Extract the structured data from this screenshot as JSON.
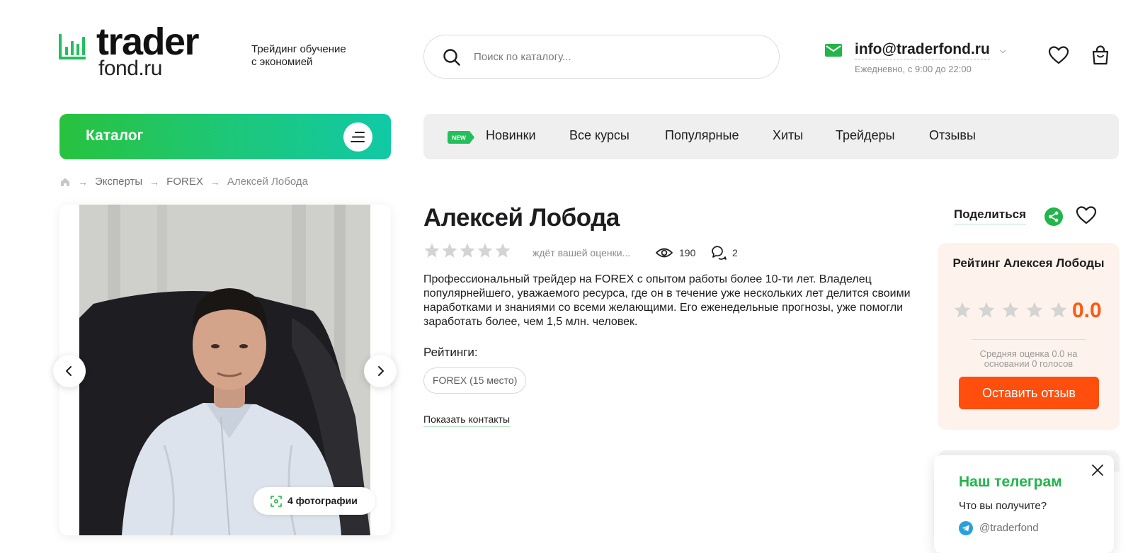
{
  "header": {
    "logo_text": "trader",
    "logo_sub": "fond.ru",
    "tagline_line1": "Трейдинг обучение",
    "tagline_line2": "с экономией",
    "search_placeholder": "Поиск по каталогу...",
    "email": "info@traderfond.ru",
    "hours": "Ежедневно, с 9:00 до 22:00"
  },
  "nav": {
    "catalog_label": "Каталог",
    "new_badge": "NEW",
    "items": [
      "Новинки",
      "Все курсы",
      "Популярные",
      "Хиты",
      "Трейдеры",
      "Отзывы"
    ]
  },
  "breadcrumb": [
    "Эксперты",
    "FOREX",
    "Алексей Лобода"
  ],
  "gallery": {
    "photos_label": "4 фотографии"
  },
  "expert": {
    "name": "Алексей Лобода",
    "rating_status": "ждёт вашей оценки...",
    "views": "190",
    "comments": "2",
    "description": "Профессиональный трейдер на FOREX с опытом работы более 10-ти лет. Владелец популярнейшего, уважаемого ресурса, где он в течение уже нескольких лет делится своими наработками и знаниями со всеми желающими. Его еженедельные прогнозы, уже помогли заработать более, чем 1,5 млн. человек.",
    "ratings_label": "Рейтинги:",
    "rating_tag": "FOREX (15 место)",
    "show_contacts": "Показать контакты"
  },
  "actions": {
    "share_label": "Поделиться"
  },
  "rating_card": {
    "title": "Рейтинг Алексея Лободы",
    "score": "0.0",
    "note": "Средняя оценка 0.0 на основании 0 голосов",
    "button": "Оставить отзыв"
  },
  "telegram": {
    "title": "Наш телеграм",
    "subtitle": "Что вы получите?",
    "handle": "@traderfond"
  },
  "colors": {
    "brand_green": "#21b54a",
    "accent_orange": "#ff4e0e",
    "star_gray": "#d4d4d4"
  }
}
